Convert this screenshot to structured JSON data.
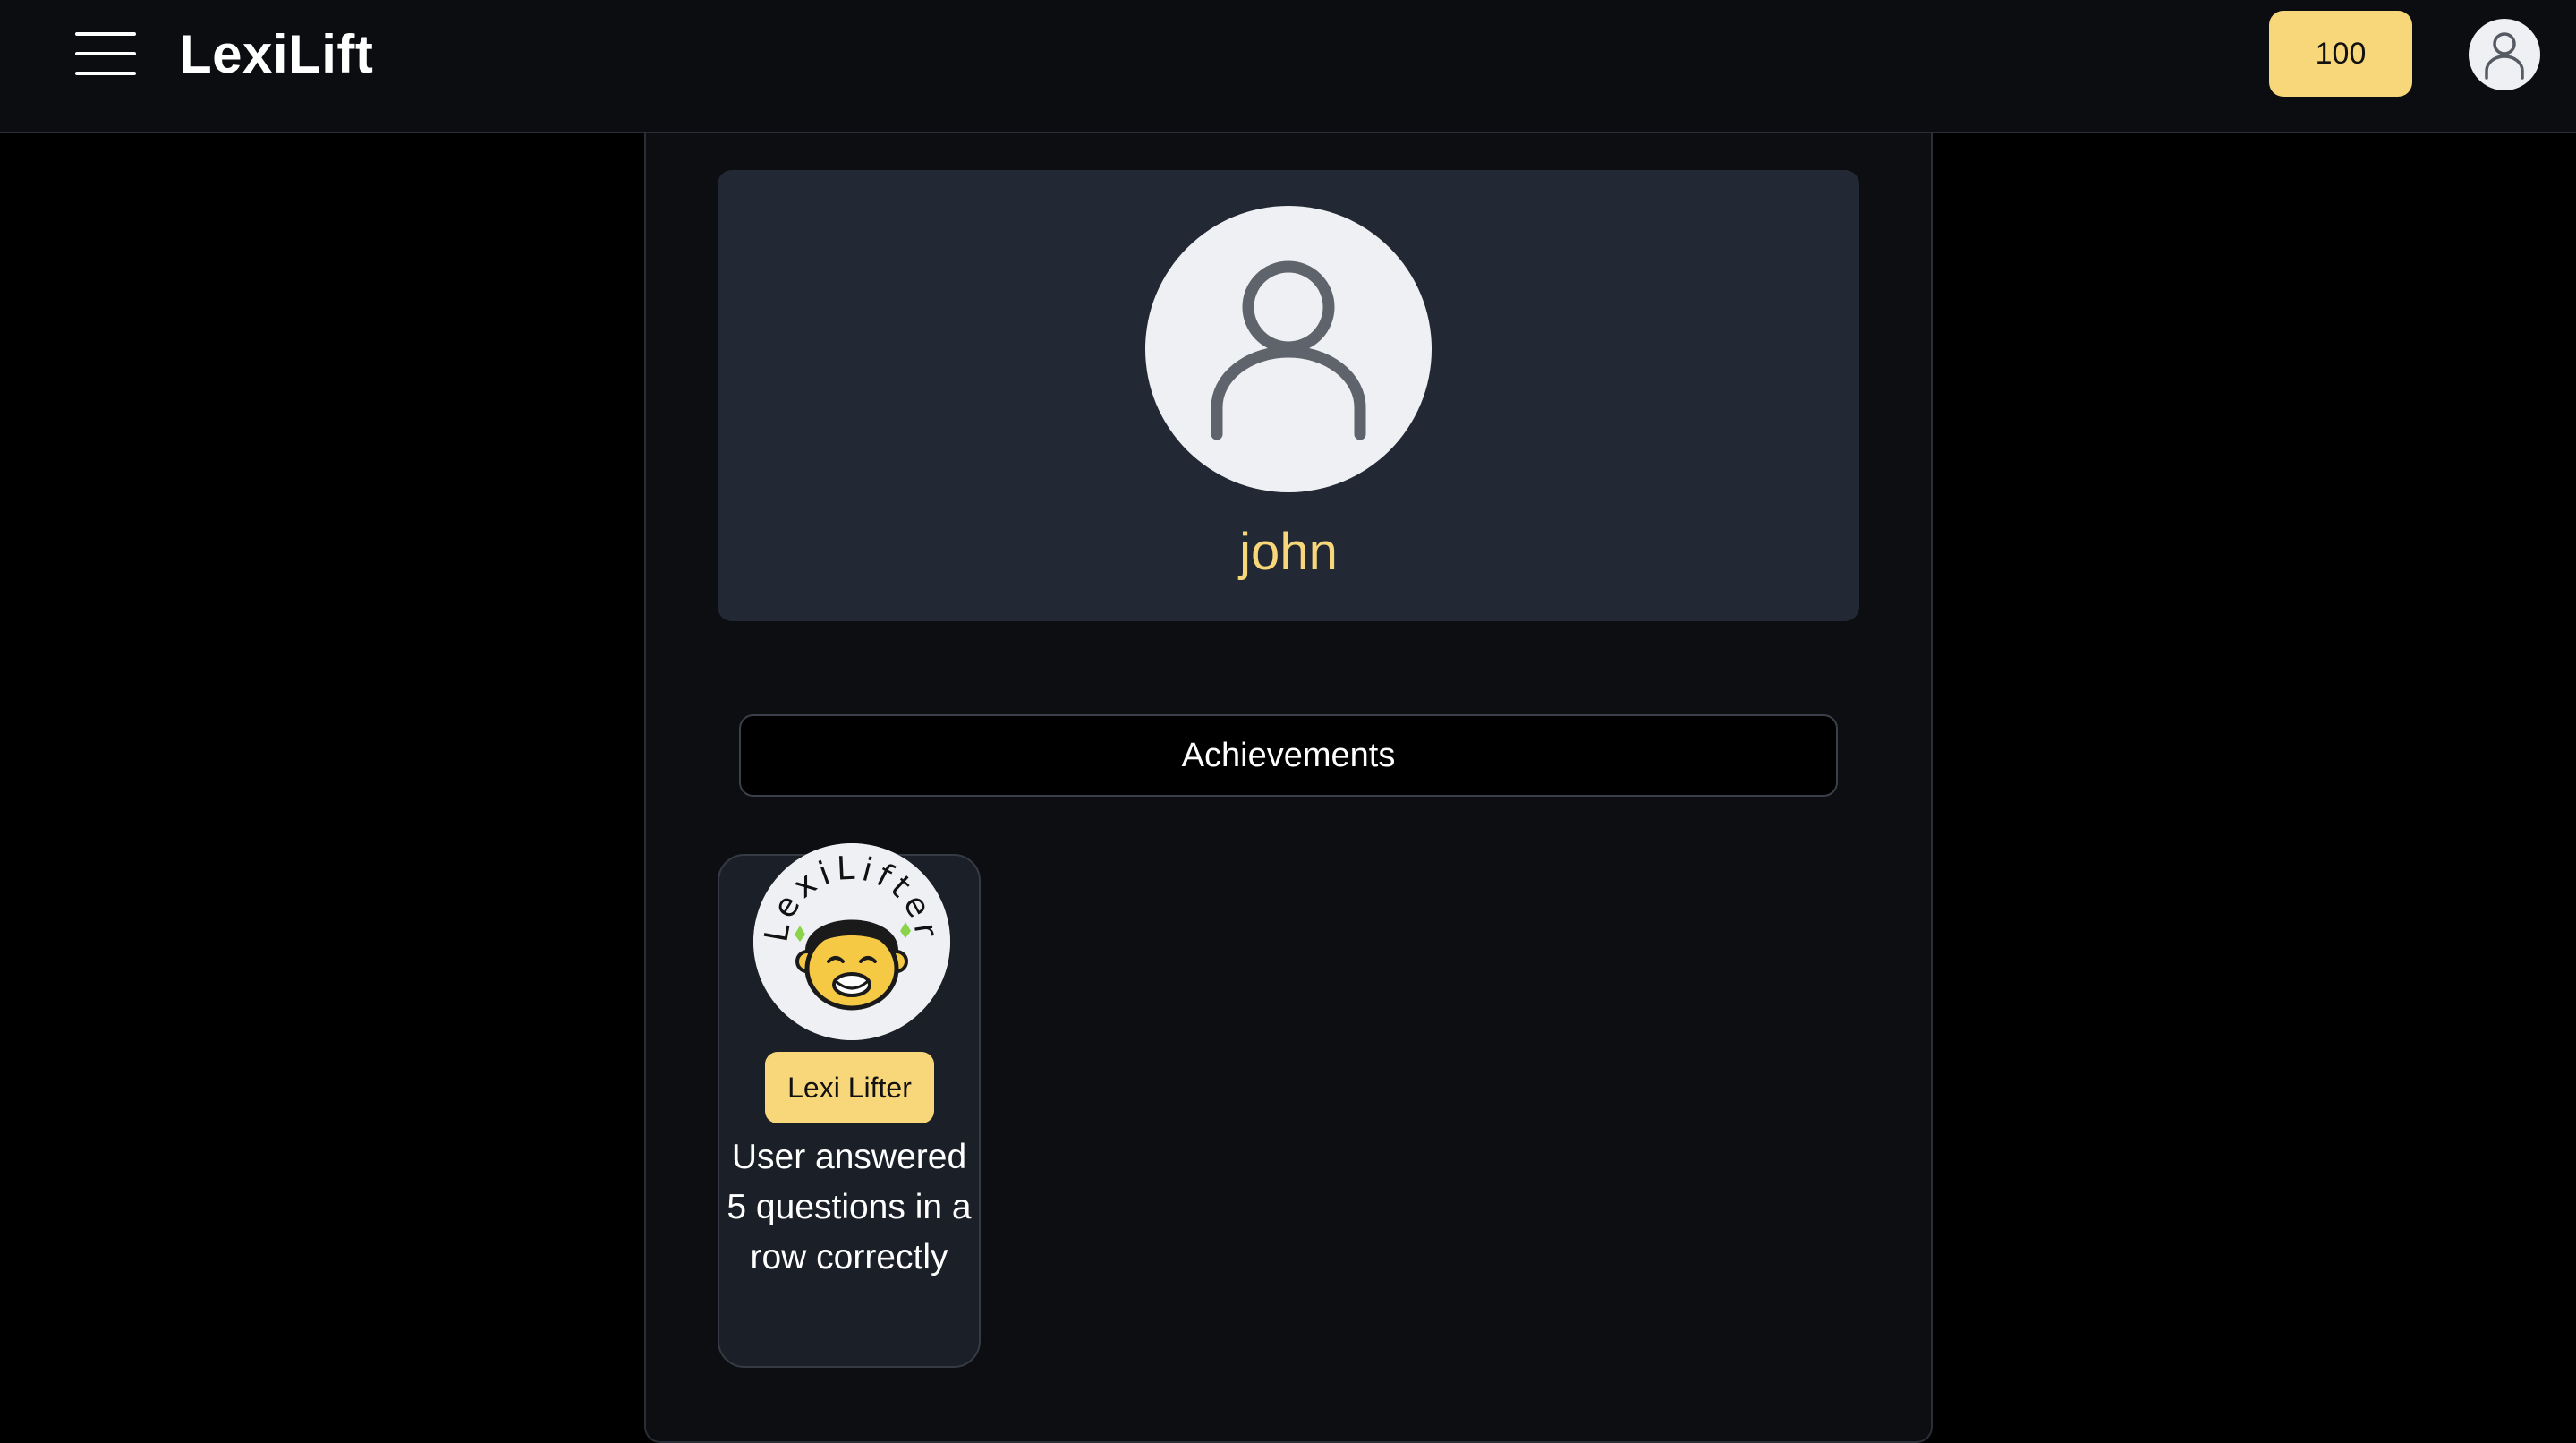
{
  "header": {
    "brand": "LexiLift",
    "points": "100"
  },
  "profile": {
    "username": "john"
  },
  "tabs": {
    "achievements_label": "Achievements"
  },
  "achievements": [
    {
      "title": "Lexi Lifter",
      "badge_text": "LexiLifter",
      "description": "User answered 5 questions in a row correctly"
    }
  ],
  "icons": {
    "menu": "hamburger-menu-icon",
    "profile": "user-icon",
    "avatar": "user-icon"
  },
  "colors": {
    "accent": "#f8d77a",
    "background": "#000000",
    "card": "#222834"
  }
}
